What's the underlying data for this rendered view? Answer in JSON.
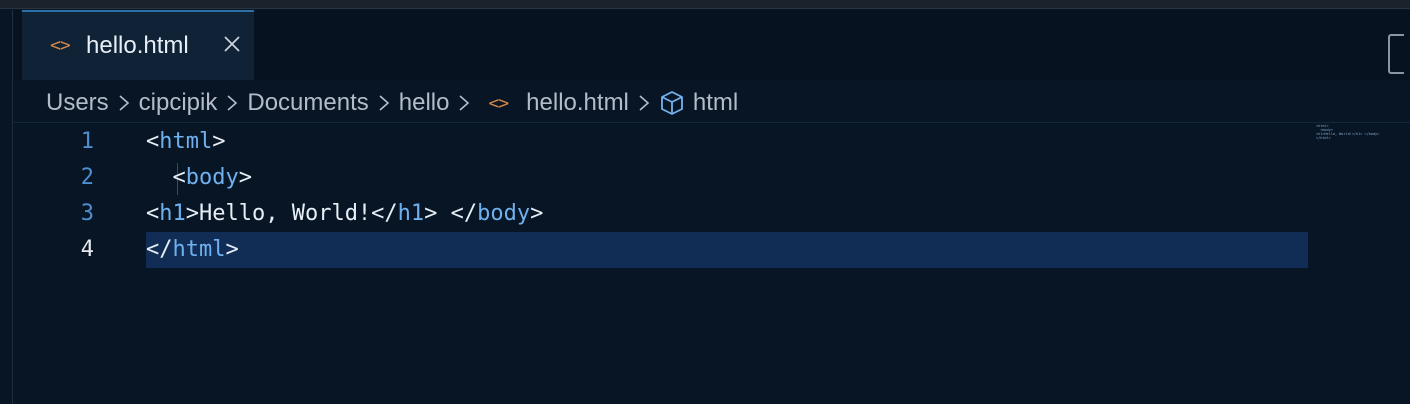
{
  "tab": {
    "icon": "<>",
    "label": "hello.html",
    "close_icon": "close-icon"
  },
  "breadcrumb": {
    "items": [
      "Users",
      "cipcipik",
      "Documents",
      "hello"
    ],
    "file_icon": "<>",
    "file": "hello.html",
    "symbol": "html"
  },
  "editor": {
    "lines": [
      {
        "number": "1",
        "parts": [
          [
            "punc",
            "<"
          ],
          [
            "tag",
            "html"
          ],
          [
            "punc",
            ">"
          ]
        ]
      },
      {
        "number": "2",
        "parts": [
          [
            "punc",
            "  <"
          ],
          [
            "tag",
            "body"
          ],
          [
            "punc",
            ">"
          ]
        ]
      },
      {
        "number": "3",
        "parts": [
          [
            "punc",
            "<"
          ],
          [
            "tag",
            "h1"
          ],
          [
            "punc",
            ">Hello, World!</"
          ],
          [
            "tag",
            "h1"
          ],
          [
            "punc",
            "> </"
          ],
          [
            "tag",
            "body"
          ],
          [
            "punc",
            ">"
          ]
        ]
      },
      {
        "number": "4",
        "parts": [
          [
            "punc",
            "</"
          ],
          [
            "tag",
            "html"
          ],
          [
            "punc",
            ">"
          ]
        ]
      }
    ],
    "active_line": "4"
  },
  "minimap": {
    "text": "<html>\n  <body>\n<h1>Hello, World!</h1> </body>\n</html>"
  },
  "colors": {
    "background": "#071525",
    "tab_active": "#0f2236",
    "tag": "#6fb1ee",
    "file_icon": "#d78745",
    "line_number": "#4f8fd0",
    "current_line": "#112d55"
  }
}
